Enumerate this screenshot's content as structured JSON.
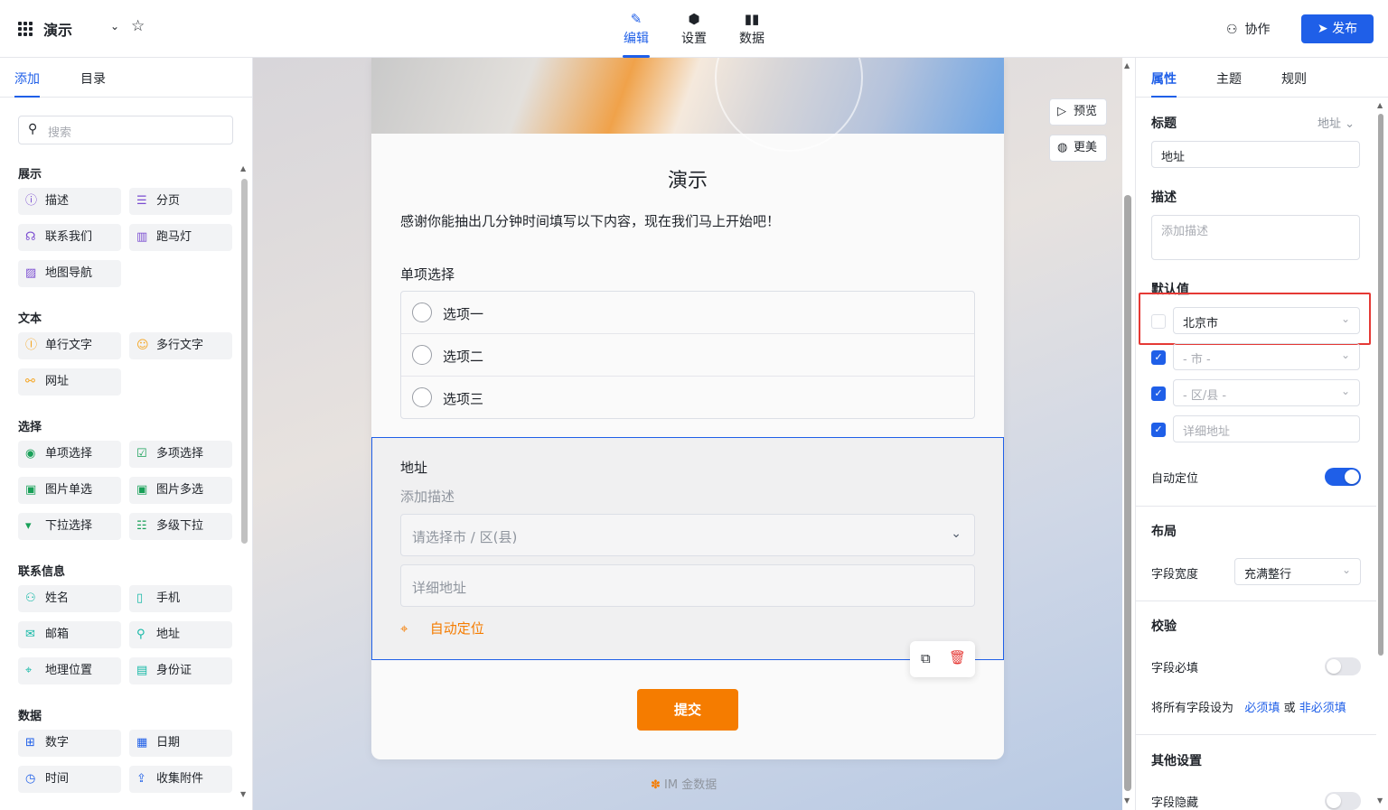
{
  "header": {
    "app_title": "演示",
    "nav": [
      {
        "label": "编辑",
        "icon": "pencil-icon"
      },
      {
        "label": "设置",
        "icon": "hexagon-icon"
      },
      {
        "label": "数据",
        "icon": "bar-chart-icon"
      }
    ],
    "collab_label": "协作",
    "publish_label": "发布"
  },
  "left": {
    "tabs": [
      "添加",
      "目录"
    ],
    "search_placeholder": "搜索",
    "groups": [
      {
        "title": "展示",
        "items": [
          "描述",
          "分页",
          "联系我们",
          "跑马灯",
          "地图导航"
        ]
      },
      {
        "title": "文本",
        "items": [
          "单行文字",
          "多行文字",
          "网址"
        ]
      },
      {
        "title": "选择",
        "items": [
          "单项选择",
          "多项选择",
          "图片单选",
          "图片多选",
          "下拉选择",
          "多级下拉"
        ]
      },
      {
        "title": "联系信息",
        "items": [
          "姓名",
          "手机",
          "邮箱",
          "地址",
          "地理位置",
          "身份证"
        ]
      },
      {
        "title": "数据",
        "items": [
          "数字",
          "日期",
          "时间",
          "收集附件"
        ]
      }
    ]
  },
  "form": {
    "title": "演示",
    "description": "感谢你能抽出几分钟时间填写以下内容，现在我们马上开始吧！",
    "single_choice": {
      "label": "单项选择",
      "options": [
        "选项一",
        "选项二",
        "选项三"
      ]
    },
    "address": {
      "label": "地址",
      "desc_placeholder": "添加描述",
      "region_placeholder": "请选择市 / 区(县)",
      "detail_placeholder": "详细地址",
      "auto_locate": "自动定位"
    },
    "submit_label": "提交",
    "footer_brand": "IM 金数据"
  },
  "canvas_side": {
    "preview_label": "预览",
    "beautify_label": "更美"
  },
  "right": {
    "tabs": [
      "属性",
      "主题",
      "规则"
    ],
    "title_section": "标题",
    "field_type": "地址",
    "title_value": "地址",
    "desc_section": "描述",
    "desc_placeholder": "添加描述",
    "default_section": "默认值",
    "province": "北京市",
    "city_placeholder": "- 市 -",
    "district_placeholder": "- 区/县 -",
    "detail_placeholder": "详细地址",
    "auto_locate_label": "自动定位",
    "layout_section": "布局",
    "field_width_label": "字段宽度",
    "field_width_value": "充满整行",
    "validate_section": "校验",
    "required_label": "字段必填",
    "set_all_prefix": "将所有字段设为",
    "set_required": "必须填",
    "or_text": "或",
    "set_optional": "非必须填",
    "other_section": "其他设置",
    "hidden_label": "字段隐藏"
  }
}
